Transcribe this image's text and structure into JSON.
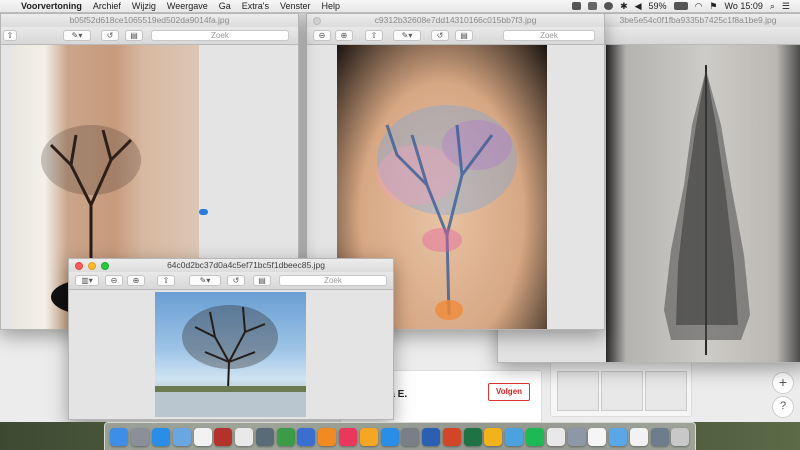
{
  "menubar": {
    "app_name": "Voorvertoning",
    "items": [
      "Archief",
      "Wijzig",
      "Weergave",
      "Ga",
      "Extra's",
      "Venster",
      "Help"
    ],
    "battery": "59%",
    "clock": "Wo 15:09"
  },
  "windows": {
    "left": {
      "title": "b05f52d618ce1065519ed502da9014fa.jpg",
      "search_placeholder": "Zoek"
    },
    "middle": {
      "title": "c9312b32608e7dd14310166c015bb7f3.jpg",
      "search_placeholder": "Zoek"
    },
    "right": {
      "title": "3be5e54c0f1fba9335b7425c1f8a1be9.jpg"
    },
    "front": {
      "title": "64c0d2bc37d0a4c5ef71bc5f1dbeec85.jpg",
      "search_placeholder": "Zoek"
    }
  },
  "webpage": {
    "user_name_partial": "ica E.",
    "follow_button": "Volgen",
    "add_button": "+",
    "help_button": "?"
  },
  "dock": {
    "items": [
      {
        "icon": "finder-icon",
        "color": "#3c8ee6"
      },
      {
        "icon": "launchpad-icon",
        "color": "#8a8f99"
      },
      {
        "icon": "safari-icon",
        "color": "#2a8de8"
      },
      {
        "icon": "preview-icon",
        "color": "#6aa7e0"
      },
      {
        "icon": "calendar-icon",
        "color": "#f2f2f2"
      },
      {
        "icon": "photo-booth-icon",
        "color": "#b5322c"
      },
      {
        "icon": "photos-icon",
        "color": "#e9e9e9"
      },
      {
        "icon": "image-capture-icon",
        "color": "#5a6b78"
      },
      {
        "icon": "numbers-icon",
        "color": "#3b9b47"
      },
      {
        "icon": "keynote-icon",
        "color": "#3a6fd1"
      },
      {
        "icon": "pages-icon",
        "color": "#f28a22"
      },
      {
        "icon": "itunes-icon",
        "color": "#e9385c"
      },
      {
        "icon": "ibooks-icon",
        "color": "#f5a623"
      },
      {
        "icon": "app-store-icon",
        "color": "#2a8de8"
      },
      {
        "icon": "system-preferences-icon",
        "color": "#7a7f87"
      },
      {
        "icon": "word-icon",
        "color": "#2b5fb4"
      },
      {
        "icon": "powerpoint-icon",
        "color": "#d24625"
      },
      {
        "icon": "excel-icon",
        "color": "#1f7244"
      },
      {
        "icon": "outlook-icon",
        "color": "#f2b21c"
      },
      {
        "icon": "network-icon",
        "color": "#4aa3df"
      },
      {
        "icon": "spotify-icon",
        "color": "#1db954"
      },
      {
        "icon": "popcorn-icon",
        "color": "#e8e8e8"
      },
      {
        "icon": "utility-icon",
        "color": "#8d97a6"
      },
      {
        "icon": "document-icon",
        "color": "#f5f5f5"
      },
      {
        "icon": "folder-icon",
        "color": "#5aa7e8"
      },
      {
        "icon": "calendar-icon",
        "color": "#f2f2f2"
      },
      {
        "icon": "screenshot-icon",
        "color": "#6d7d8c"
      },
      {
        "icon": "trash-icon",
        "color": "#c8c8c8"
      }
    ]
  }
}
